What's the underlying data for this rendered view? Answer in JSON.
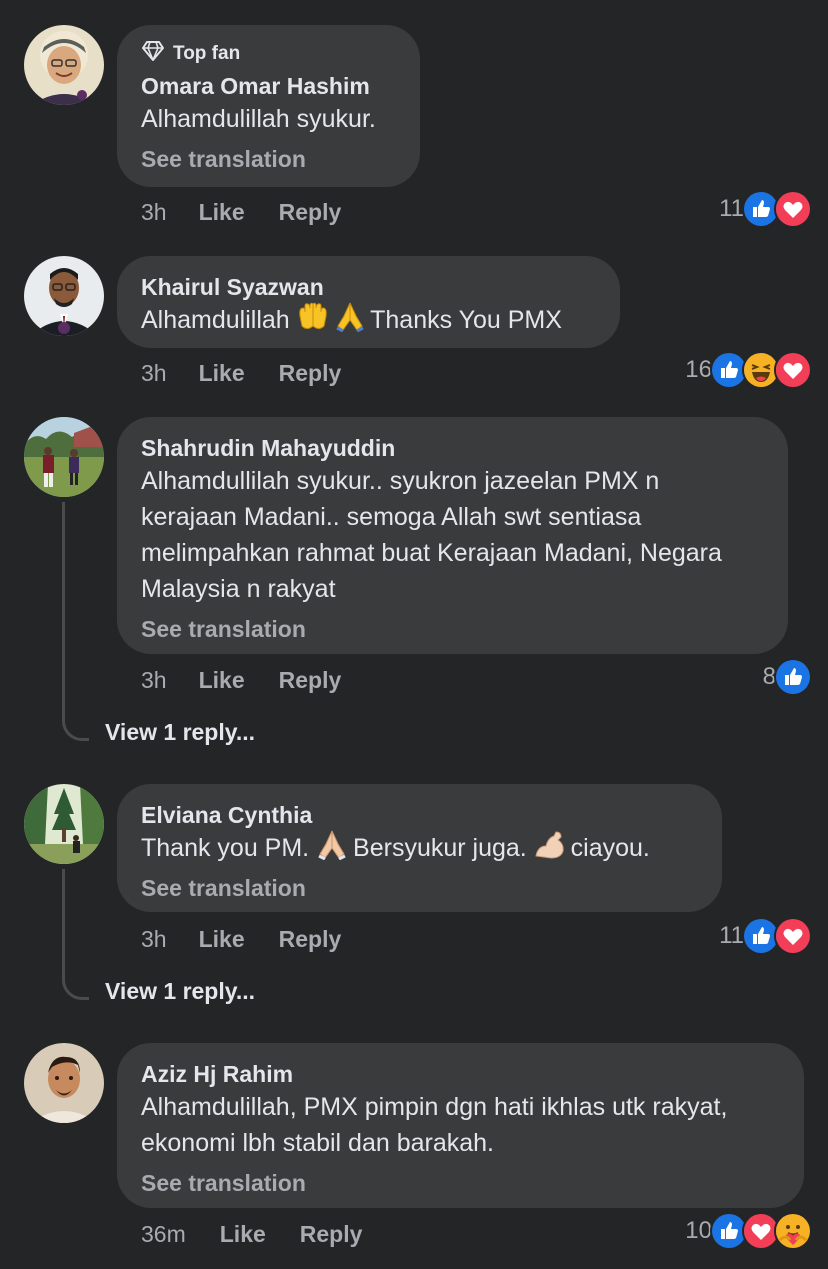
{
  "comments": [
    {
      "badge_icon": "diamond-icon",
      "badge": "Top fan",
      "author": "Omara Omar Hashim",
      "text": "Alhamdulillah syukur.",
      "see_translation": "See translation",
      "time": "3h",
      "like": "Like",
      "reply": "Reply",
      "reaction_count": "11",
      "reactions": [
        "like",
        "love"
      ]
    },
    {
      "author": "Khairul Syazwan",
      "text_before": "Alhamdulillah",
      "emoji_1": "open-hands-emoji",
      "emoji_2": "folded-hands-emoji",
      "text_after": "Thanks You PMX",
      "time": "3h",
      "like": "Like",
      "reply": "Reply",
      "reaction_count": "16",
      "reactions": [
        "like",
        "haha",
        "love"
      ]
    },
    {
      "author": "Shahrudin Mahayuddin",
      "text": "Alhamdullilah syukur.. syukron jazeelan PMX n\nkerajaan Madani.. semoga Allah swt sentiasa\nmelimpahkan rahmat buat Kerajaan Madani, Negara\nMalaysia n rakyat",
      "see_translation": "See translation",
      "time": "3h",
      "like": "Like",
      "reply": "Reply",
      "reaction_count": "8",
      "reactions": [
        "like"
      ],
      "view_replies": "View 1 reply..."
    },
    {
      "author": "Elviana Cynthia",
      "text_part_1": "Thank you PM.",
      "emoji_1": "folded-hands-emoji",
      "text_part_2": "Bersyukur juga.",
      "emoji_2": "flexed-biceps-emoji",
      "text_part_3": "ciayou.",
      "see_translation": "See translation",
      "time": "3h",
      "like": "Like",
      "reply": "Reply",
      "reaction_count": "11",
      "reactions": [
        "like",
        "love"
      ],
      "view_replies": "View 1 reply..."
    },
    {
      "author": "Aziz Hj Rahim",
      "text": "Alhamdulillah, PMX pimpin dgn hati ikhlas utk rakyat,\nekonomi lbh stabil dan barakah.",
      "see_translation": "See translation",
      "time": "36m",
      "like": "Like",
      "reply": "Reply",
      "reaction_count": "10",
      "reactions": [
        "like",
        "love",
        "care"
      ]
    }
  ],
  "colors": {
    "background": "#242527",
    "bubble": "#3a3b3d",
    "text": "#e4e6eb",
    "muted": "#a8abaf",
    "like_blue": "#1b74e4",
    "love_red": "#f33e58",
    "haha_yellow": "#f7b125"
  }
}
